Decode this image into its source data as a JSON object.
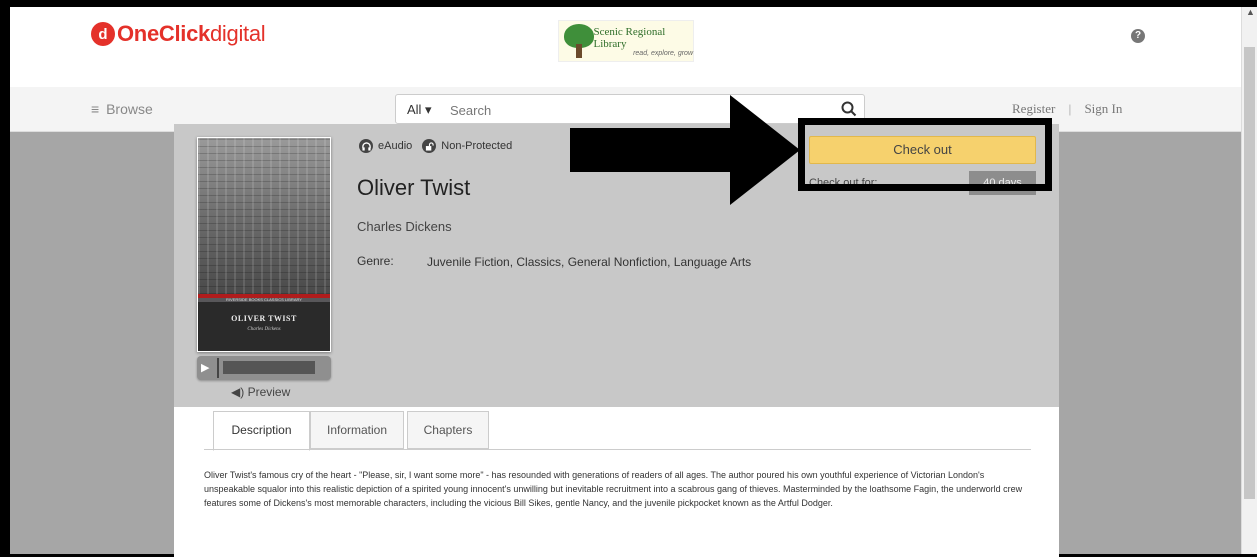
{
  "brand": {
    "logo_letter": "d",
    "name_bold": "OneClick",
    "name_light": "digital"
  },
  "library": {
    "name": "Scenic Regional Library",
    "tagline": "read, explore, grow"
  },
  "header": {
    "help_icon": "?"
  },
  "nav": {
    "browse_icon": "≡",
    "browse_label": "Browse",
    "search_scope": "All ▾",
    "search_placeholder": "Search",
    "register": "Register",
    "separator": "|",
    "sign_in": "Sign In"
  },
  "book": {
    "format": "eAudio",
    "protection": "Non-Protected",
    "title": "Oliver Twist",
    "author": "Charles Dickens",
    "genre_label": "Genre:",
    "genre_value": "Juvenile Fiction, Classics, General Nonfiction, Language Arts",
    "cover_series": "RIVERSIDE BOOKS CLASSICS LIBRARY",
    "cover_title": "OLIVER TWIST",
    "cover_author": "Charles Dickens"
  },
  "player": {
    "play_icon": "▶",
    "preview_icon": "◀)",
    "preview_label": "Preview"
  },
  "checkout": {
    "button_label": "Check out",
    "period_label": "Check out for:",
    "period_value": "40 days"
  },
  "tabs": [
    "Description",
    "Information",
    "Chapters"
  ],
  "description": "Oliver Twist's famous cry of the heart - \"Please, sir, I want some more\" - has resounded with generations of readers of all ages. The author poured his own youthful experience of Victorian London's unspeakable squalor into this realistic depiction of a spirited young innocent's unwilling but inevitable recruitment into a scabrous gang of thieves. Masterminded by the loathsome Fagin, the underworld crew features some of Dickens's most memorable characters, including the vicious Bill Sikes, gentle Nancy, and the juvenile pickpocket known as the Artful Dodger.",
  "colors": {
    "brand_red": "#e4312a",
    "checkout_yellow": "#f6d16d",
    "annotation": "#000000"
  }
}
